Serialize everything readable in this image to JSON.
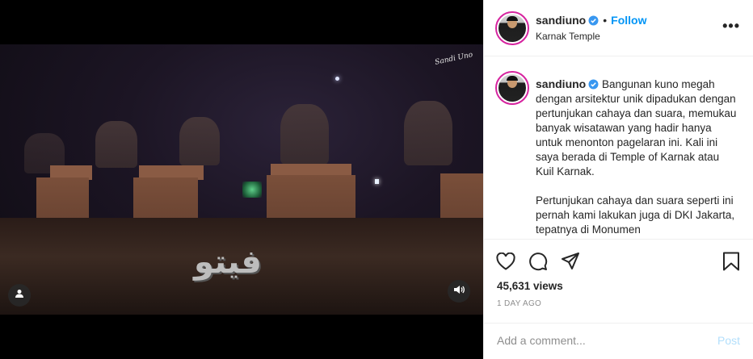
{
  "header": {
    "username": "sandiuno",
    "separator": "•",
    "follow_label": "Follow",
    "location": "Karnak Temple",
    "more_label": "•••"
  },
  "caption": {
    "username": "sandiuno",
    "paragraph1": "Bangunan kuno megah dengan arsitektur unik dipadukan dengan pertunjukan cahaya dan suara, memukau banyak wisatawan yang hadir hanya untuk menonton pagelaran ini. Kali ini saya berada di Temple of Karnak atau Kuil Karnak.",
    "paragraph2": "Pertunjukan cahaya dan suara seperti ini pernah kami lakukan juga di DKI Jakarta, tepatnya di Monumen"
  },
  "stats": {
    "views": "45,631 views",
    "time_ago": "1 DAY AGO"
  },
  "comment": {
    "placeholder": "Add a comment...",
    "post_label": "Post"
  },
  "video": {
    "watermark": "فيتو",
    "signature": "Sandi Uno"
  },
  "icons": {
    "verified": "verified-badge-icon",
    "like": "heart-icon",
    "comment": "comment-bubble-icon",
    "share": "paper-plane-icon",
    "save": "bookmark-icon",
    "tag": "user-tag-icon",
    "audio": "speaker-icon"
  },
  "colors": {
    "accent": "#0095f6",
    "verified": "#3897f0",
    "post_disabled": "#b2dffc",
    "muted_text": "#8e8e8e"
  }
}
